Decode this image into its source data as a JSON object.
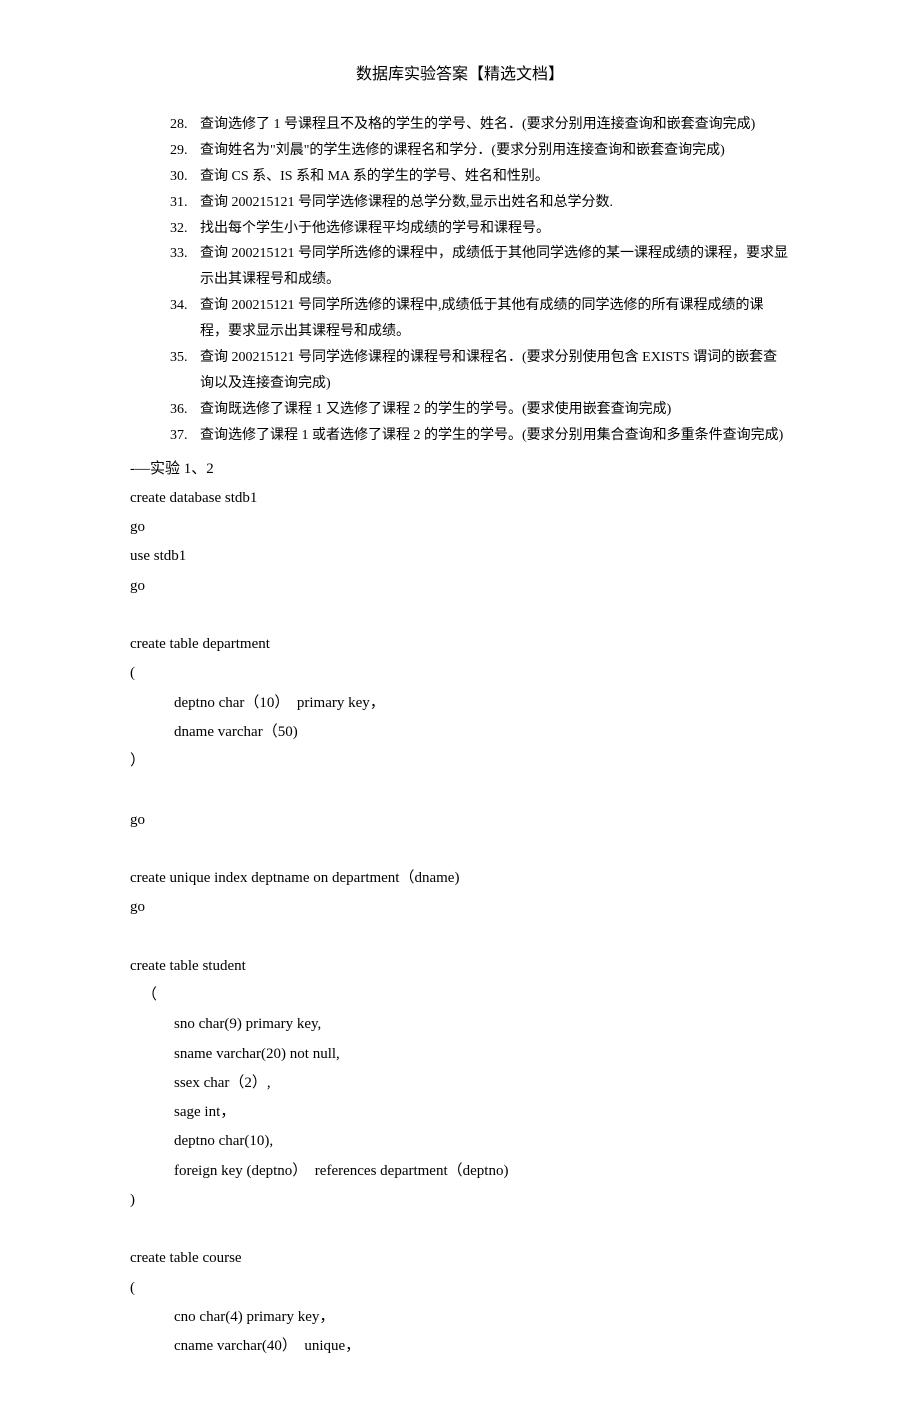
{
  "title": "数据库实验答案【精选文档】",
  "items": [
    {
      "num": "28.",
      "text": "查询选修了 1 号课程且不及格的学生的学号、姓名．(要求分别用连接查询和嵌套查询完成)"
    },
    {
      "num": "29.",
      "text": "查询姓名为\"刘晨\"的学生选修的课程名和学分．(要求分别用连接查询和嵌套查询完成)"
    },
    {
      "num": "30.",
      "text": "查询 CS 系、IS 系和 MA 系的学生的学号、姓名和性别。"
    },
    {
      "num": "31.",
      "text": "查询 200215121 号同学选修课程的总学分数,显示出姓名和总学分数."
    },
    {
      "num": "32.",
      "text": "找出每个学生小于他选修课程平均成绩的学号和课程号。"
    },
    {
      "num": "33.",
      "text": "查询 200215121 号同学所选修的课程中，成绩低于其他同学选修的某一课程成绩的课程，要求显示出其课程号和成绩。"
    },
    {
      "num": "34.",
      "text": "查询 200215121 号同学所选修的课程中,成绩低于其他有成绩的同学选修的所有课程成绩的课程，要求显示出其课程号和成绩。"
    },
    {
      "num": "35.",
      "text": "查询 200215121 号同学选修课程的课程号和课程名．(要求分别使用包含 EXISTS 谓词的嵌套查询以及连接查询完成)"
    },
    {
      "num": "36.",
      "text": "查询既选修了课程 1 又选修了课程 2 的学生的学号。(要求使用嵌套查询完成)"
    },
    {
      "num": "37.",
      "text": "查询选修了课程 1 或者选修了课程 2 的学生的学号。(要求分别用集合查询和多重条件查询完成)"
    }
  ],
  "code": [
    {
      "cls": "",
      "text": "-—实验 1、2"
    },
    {
      "cls": "",
      "text": "create database stdb1"
    },
    {
      "cls": "",
      "text": "go"
    },
    {
      "cls": "",
      "text": "use stdb1"
    },
    {
      "cls": "",
      "text": "go"
    },
    {
      "cls": "",
      "text": " "
    },
    {
      "cls": "",
      "text": "create table department"
    },
    {
      "cls": "",
      "text": "("
    },
    {
      "cls": "indent1",
      "text": "deptno char（10）  primary key，"
    },
    {
      "cls": "indent1",
      "text": "dname varchar（50)"
    },
    {
      "cls": "",
      "text": "）"
    },
    {
      "cls": "",
      "text": " "
    },
    {
      "cls": "",
      "text": "go"
    },
    {
      "cls": "",
      "text": " "
    },
    {
      "cls": "",
      "text": "create unique index deptname on department（dname)"
    },
    {
      "cls": "",
      "text": "go"
    },
    {
      "cls": "",
      "text": " "
    },
    {
      "cls": "",
      "text": "create table student"
    },
    {
      "cls": "indent-paren",
      "text": "（"
    },
    {
      "cls": "indent1",
      "text": "sno char(9) primary key,"
    },
    {
      "cls": "indent1",
      "text": "sname varchar(20) not null,"
    },
    {
      "cls": "indent1",
      "text": "ssex char（2）,"
    },
    {
      "cls": "indent1",
      "text": "sage int，"
    },
    {
      "cls": "indent1",
      "text": "deptno char(10),"
    },
    {
      "cls": "indent1",
      "text": "foreign key (deptno）  references department（deptno)"
    },
    {
      "cls": "",
      "text": ")"
    },
    {
      "cls": "",
      "text": " "
    },
    {
      "cls": "",
      "text": "create table course"
    },
    {
      "cls": "",
      "text": "("
    },
    {
      "cls": "indent1",
      "text": "cno char(4) primary key，"
    },
    {
      "cls": "indent1",
      "text": "cname varchar(40）  unique，"
    }
  ]
}
